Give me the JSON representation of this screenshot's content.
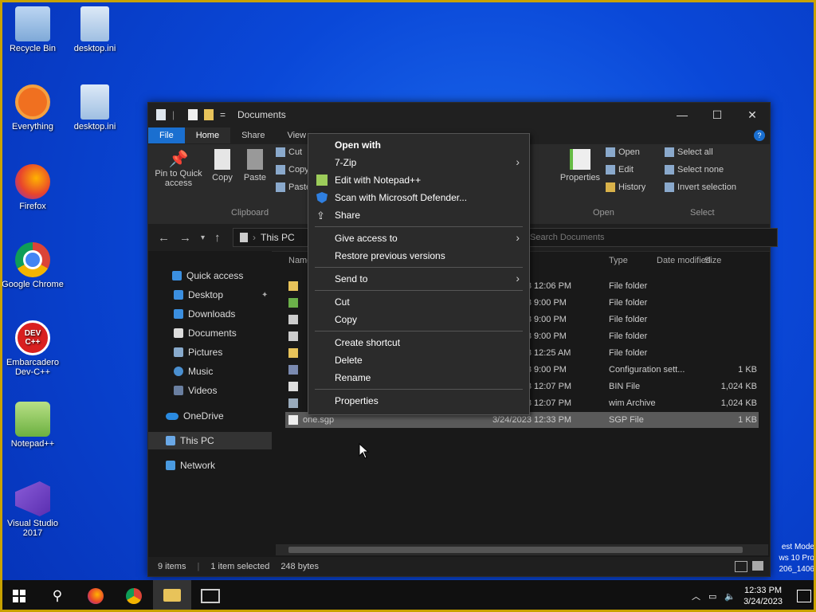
{
  "desktop": {
    "icons": [
      {
        "label": "Recycle Bin"
      },
      {
        "label": "desktop.ini"
      },
      {
        "label": "Everything"
      },
      {
        "label": "desktop.ini"
      },
      {
        "label": "Firefox"
      },
      {
        "label": "Google Chrome"
      },
      {
        "label": "Embarcadero Dev-C++"
      },
      {
        "label": "Notepad++"
      },
      {
        "label": "Visual Studio 2017"
      }
    ],
    "watermark": [
      "est Mode",
      "ws 10 Pro",
      "206_1406"
    ]
  },
  "explorer": {
    "title": "Documents",
    "tabs": [
      "File",
      "Home",
      "Share",
      "View"
    ],
    "ribbon": {
      "pin": "Pin to Quick access",
      "copy": "Copy",
      "paste": "Paste",
      "cut": "Cut",
      "copy_path": "Copy path",
      "paste_shortcut": "Paste shortcut",
      "clipboard_group": "Clipboard",
      "properties": "Properties",
      "open": "Open",
      "edit": "Edit",
      "history": "History",
      "open_group": "Open",
      "select_all": "Select all",
      "select_none": "Select none",
      "invert_selection": "Invert selection",
      "select_group": "Select"
    },
    "address": "This PC",
    "search_placeholder": "Search Documents",
    "nav": {
      "quick_access": "Quick access",
      "desktop": "Desktop",
      "downloads": "Downloads",
      "documents": "Documents",
      "pictures": "Pictures",
      "music": "Music",
      "videos": "Videos",
      "onedrive": "OneDrive",
      "this_pc": "This PC",
      "network": "Network"
    },
    "columns": {
      "name": "Name",
      "modified": "Date modified",
      "type": "Type",
      "size": "Size"
    },
    "files": [
      {
        "date": "3/24/2023 12:06 PM",
        "type": "File folder",
        "size": ""
      },
      {
        "date": "3/24/2023 9:00 PM",
        "type": "File folder",
        "size": ""
      },
      {
        "date": "3/24/2023 9:00 PM",
        "type": "File folder",
        "size": ""
      },
      {
        "date": "3/24/2023 9:00 PM",
        "type": "File folder",
        "size": ""
      },
      {
        "date": "3/24/2023 12:25 AM",
        "type": "File folder",
        "size": ""
      },
      {
        "date": "3/24/2023 9:00 PM",
        "type": "Configuration sett...",
        "size": "1 KB"
      },
      {
        "date": "3/24/2023 12:07 PM",
        "type": "BIN File",
        "size": "1,024 KB"
      },
      {
        "date": "3/24/2023 12:07 PM",
        "type": "wim Archive",
        "size": "1,024 KB"
      },
      {
        "name": "one.sgp",
        "date": "3/24/2023 12:33 PM",
        "type": "SGP File",
        "size": "1 KB"
      }
    ],
    "status": {
      "items": "9 items",
      "selected": "1 item selected",
      "size": "248 bytes"
    }
  },
  "context_menu": {
    "items": [
      {
        "label": "Open with",
        "bold": true
      },
      {
        "label": "7-Zip",
        "submenu": true
      },
      {
        "label": "Edit with Notepad++",
        "icon": "notepadpp-icon"
      },
      {
        "label": "Scan with Microsoft Defender...",
        "icon": "defender-shield-icon"
      },
      {
        "label": "Share",
        "icon": "share-icon"
      },
      {
        "label": "Give access to",
        "submenu": true
      },
      {
        "label": "Restore previous versions"
      },
      {
        "label": "Send to",
        "submenu": true
      },
      {
        "label": "Cut"
      },
      {
        "label": "Copy"
      },
      {
        "label": "Create shortcut"
      },
      {
        "label": "Delete"
      },
      {
        "label": "Rename"
      },
      {
        "label": "Properties"
      }
    ]
  },
  "taskbar": {
    "time": "12:33 PM",
    "date": "3/24/2023"
  }
}
